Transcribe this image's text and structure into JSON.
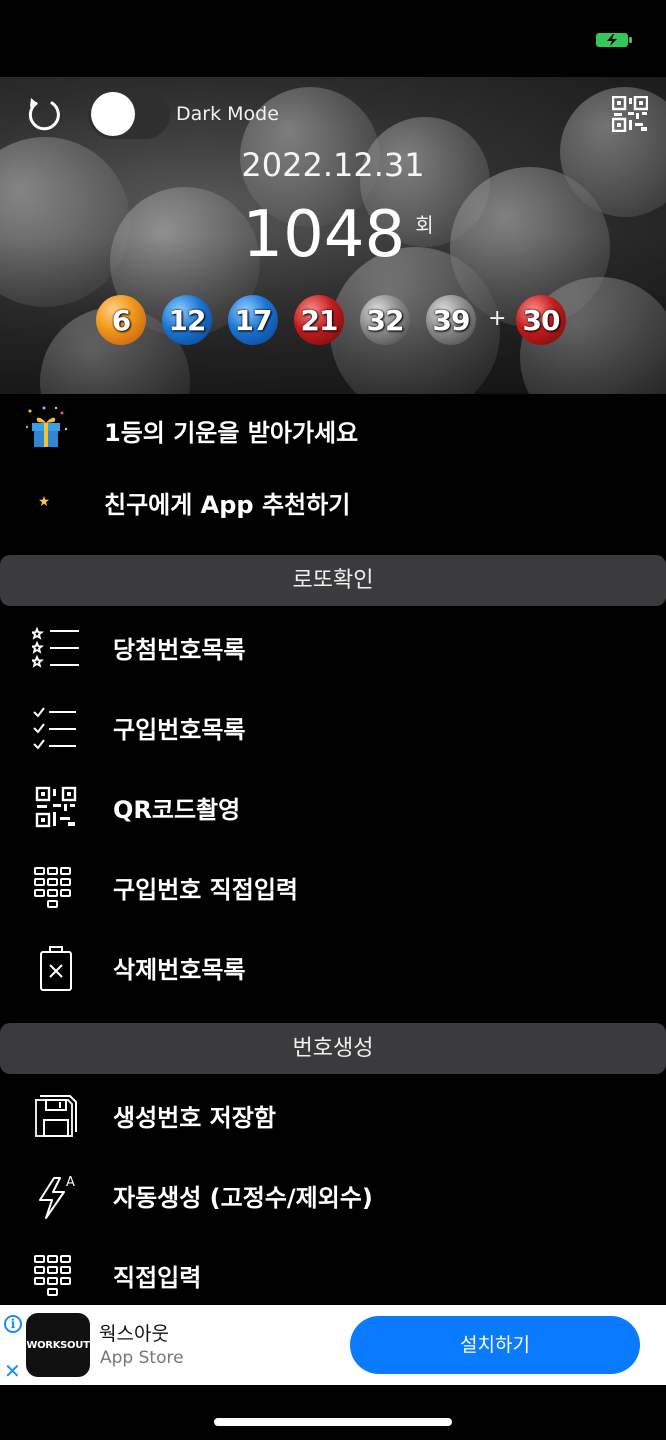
{
  "colors": {
    "background": "#000000",
    "section_header": "#3b3b3d",
    "battery_green": "#35c759",
    "ad_accent": "#0a7aff"
  },
  "header": {
    "refresh_icon": "refresh-icon",
    "dark_mode_label": "Dark Mode",
    "dark_mode_on": false,
    "qr_icon": "qr-code-icon"
  },
  "draw": {
    "date": "2022.12.31",
    "round": "1048",
    "round_suffix": "회",
    "numbers": [
      {
        "value": "6",
        "color": "orange"
      },
      {
        "value": "12",
        "color": "blue"
      },
      {
        "value": "17",
        "color": "blue"
      },
      {
        "value": "21",
        "color": "red"
      },
      {
        "value": "32",
        "color": "gray"
      },
      {
        "value": "39",
        "color": "gray"
      }
    ],
    "plus": "+",
    "bonus": {
      "value": "30",
      "color": "red"
    }
  },
  "promo": [
    {
      "label": "1등의 기운을 받아가세요",
      "icon": "gift-icon"
    },
    {
      "label": "친구에게 App 추천하기",
      "icon": "star-icon"
    }
  ],
  "sections": {
    "check_title": "로또확인",
    "check_items": [
      {
        "label": "당첨번호목록",
        "icon": "star-list-icon"
      },
      {
        "label": "구입번호목록",
        "icon": "check-list-icon"
      },
      {
        "label": "QR코드촬영",
        "icon": "qr-scan-icon"
      },
      {
        "label": "구입번호 직접입력",
        "icon": "keypad-icon"
      },
      {
        "label": "삭제번호목록",
        "icon": "trash-icon"
      }
    ],
    "generate_title": "번호생성",
    "generate_items": [
      {
        "label": "생성번호 저장함",
        "icon": "save-icon"
      },
      {
        "label": "자동생성 (고정수/제외수)",
        "icon": "auto-flash-icon"
      },
      {
        "label": "직접입력",
        "icon": "keypad-icon"
      }
    ]
  },
  "ad": {
    "logo_text": "WORKSOUT",
    "title": "웍스아웃",
    "subtitle": "App Store",
    "install_label": "설치하기",
    "info_icon": "info-icon",
    "close_icon": "close-icon"
  }
}
